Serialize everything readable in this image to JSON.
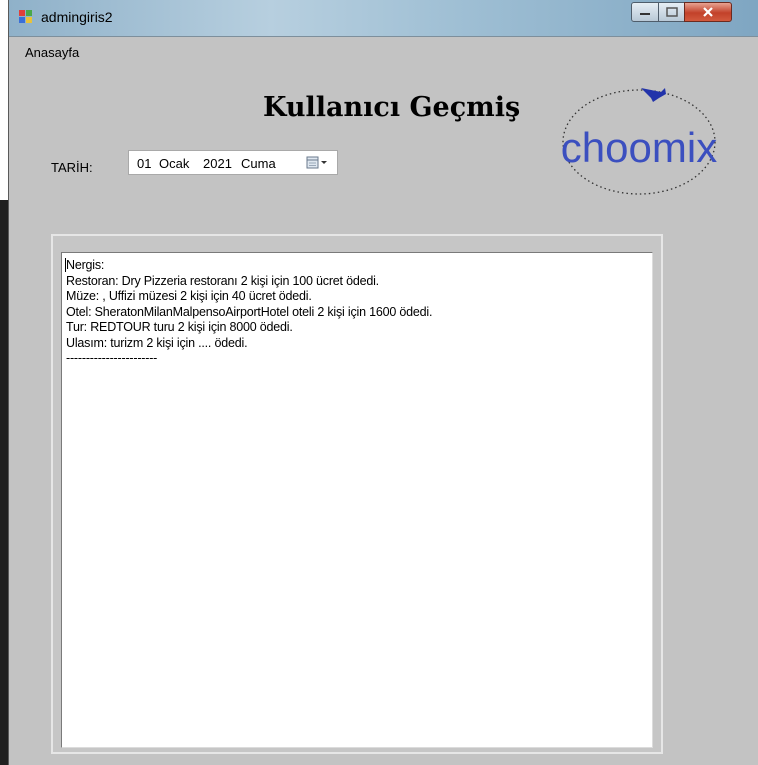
{
  "window": {
    "title": "admingiris2"
  },
  "menu": {
    "items": [
      "Anasayfa"
    ]
  },
  "form": {
    "heading": "Kullanıcı Geçmiş",
    "logo_text": "choomix",
    "date_label": "TARİH:",
    "date": {
      "day": "01",
      "month": "Ocak",
      "year": "2021",
      "weekday": "Cuma"
    }
  },
  "history": {
    "lines": [
      "Nergis:",
      "Restoran: Dry Pizzeria restoranı 2 kişi için 100 ücret ödedi.",
      "Müze: , Uffizi müzesi 2 kişi için 40 ücret ödedi.",
      "Otel: SheratonMilanMalpensoAirportHotel oteli 2 kişi için 1600 ödedi.",
      "Tur: REDTOUR turu 2 kişi için 8000 ödedi.",
      "Ulasım: turizm 2 kişi için .... ödedi.",
      "-----------------------"
    ]
  },
  "colors": {
    "form_bg": "#c3c3c3",
    "logo_text": "#3b4fbf",
    "logo_plane": "#2233aa",
    "close_button": "#c2412a"
  },
  "icons": [
    "app-icon",
    "minimize-icon",
    "maximize-icon",
    "close-icon",
    "calendar-icon",
    "dropdown-arrow-icon",
    "airplane-icon"
  ]
}
